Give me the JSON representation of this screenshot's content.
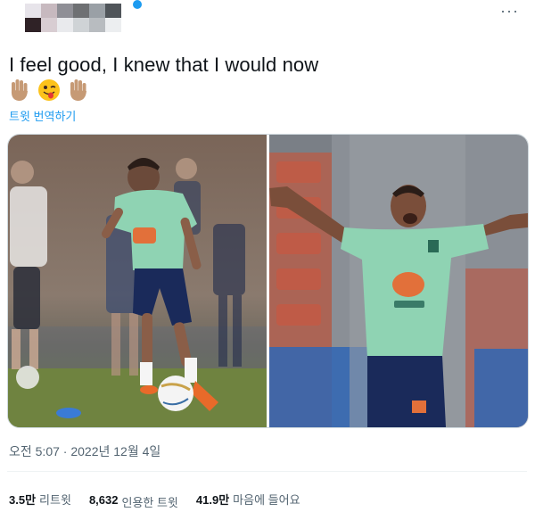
{
  "tweet": {
    "text": "I feel good, I knew that I would now",
    "emojis": [
      "raised-hand",
      "winking-face-with-tongue",
      "raised-hand"
    ],
    "translate_label": "트윗 번역하기",
    "timestamp": "오전 5:07 · 2022년 12월 4일"
  },
  "stats": [
    {
      "value": "3.5만",
      "label": "리트윗"
    },
    {
      "value": "8,632",
      "label": "인용한 트윗"
    },
    {
      "value": "41.9만",
      "label": "마음에 들어요"
    }
  ],
  "colors": {
    "accent": "#1d9bf0",
    "text": "#0f1419",
    "muted": "#536471",
    "jersey": "#8fd3b3",
    "shorts": "#1a2a5a"
  },
  "header": {
    "avatar_pixelated": true,
    "more_icon": "more-horizontal-icon"
  }
}
